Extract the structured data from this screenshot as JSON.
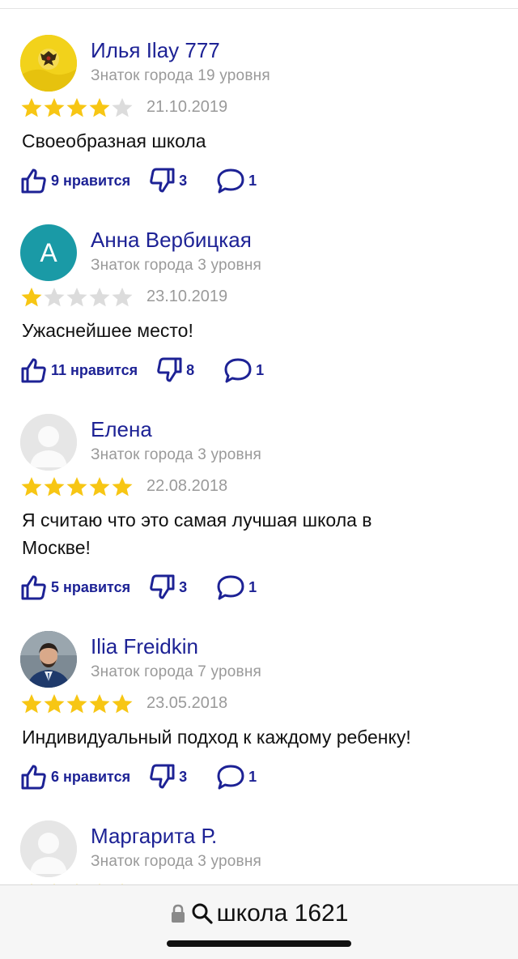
{
  "reviews": [
    {
      "author": "Илья Ilay 777",
      "level": "Знаток города 19 уровня",
      "rating": 4,
      "date": "21.10.2019",
      "text": "Своеобразная школа",
      "likes": "9 нравится",
      "dislikes": "3",
      "comments": "1",
      "avatar": "yellow-emblem",
      "avatar_color": "#f2d21b"
    },
    {
      "author": "Анна Вербицкая",
      "level": "Знаток города 3 уровня",
      "rating": 1,
      "date": "23.10.2019",
      "text": "Ужаснейшее место!",
      "likes": "11 нравится",
      "dislikes": "8",
      "comments": "1",
      "avatar": "letter",
      "avatar_letter": "А",
      "avatar_color": "#1a9aa6"
    },
    {
      "author": "Елена",
      "level": "Знаток города 3 уровня",
      "rating": 5,
      "date": "22.08.2018",
      "text": "Я считаю что это самая лучшая школа в Москве!",
      "likes": "5 нравится",
      "dislikes": "3",
      "comments": "1",
      "avatar": "placeholder",
      "avatar_color": "#e6e6e6"
    },
    {
      "author": "Ilia Freidkin",
      "level": "Знаток города 7 уровня",
      "rating": 5,
      "date": "23.05.2018",
      "text": "Индивидуальный подход к каждому ребенку!",
      "likes": "6 нравится",
      "dislikes": "3",
      "comments": "1",
      "avatar": "photo",
      "avatar_color": "#6e7b86"
    },
    {
      "author": "Маргарита Р.",
      "level": "Знаток города 3 уровня",
      "rating": 5,
      "avatar": "placeholder",
      "avatar_color": "#e6e6e6"
    }
  ],
  "address_bar": {
    "query": "школа 1621",
    "lock_icon": "lock-icon",
    "search_icon": "search-icon"
  },
  "colors": {
    "accent": "#1d2295",
    "star_filled": "#f7c614",
    "star_empty": "#dcdcdc",
    "meta_text": "#9a9a9a"
  }
}
